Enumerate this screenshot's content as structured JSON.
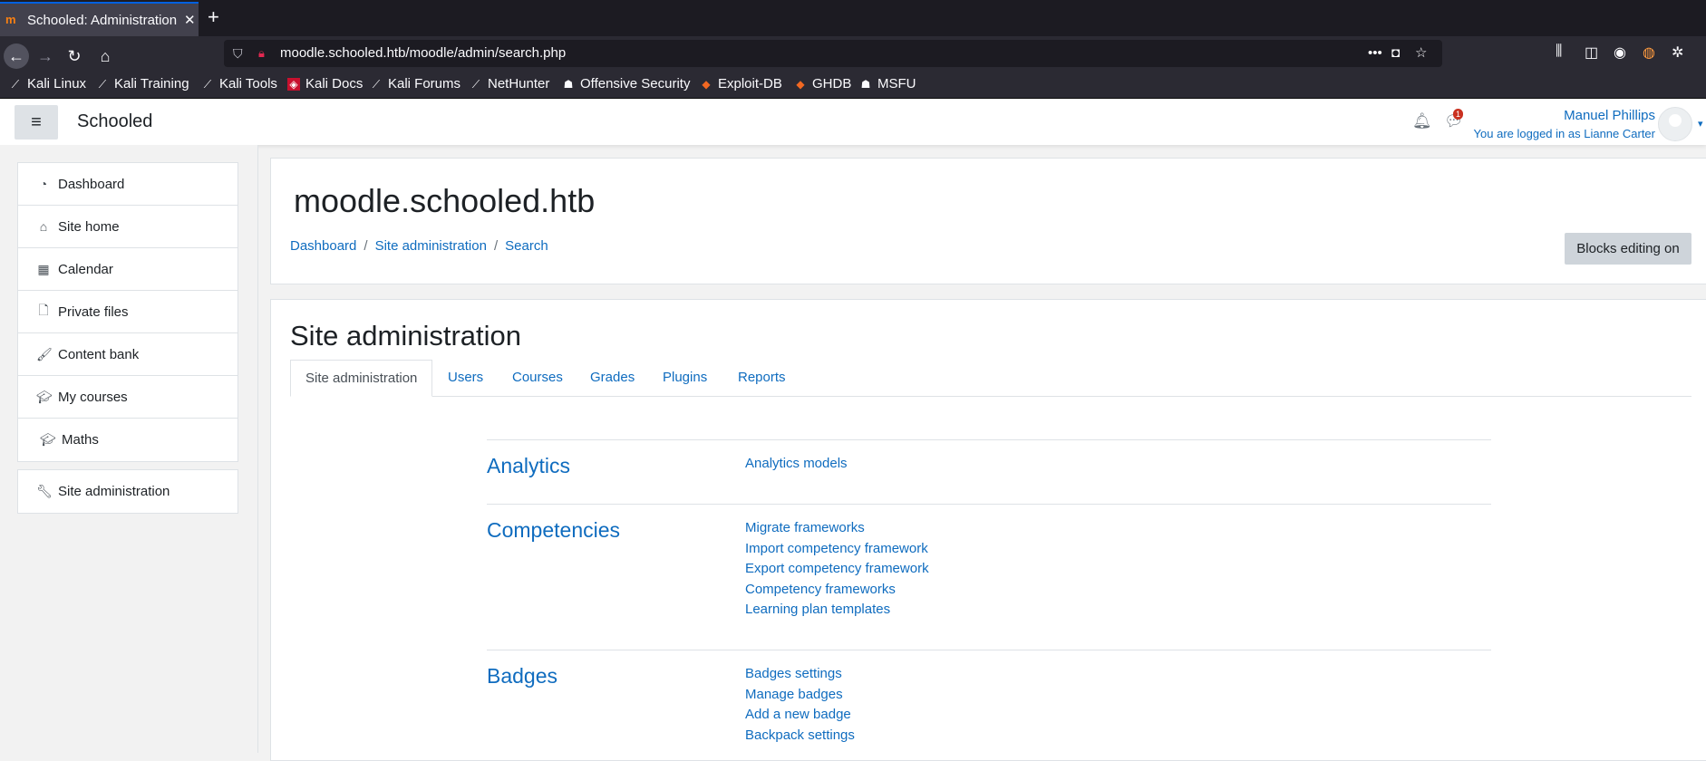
{
  "browser": {
    "tab_title": "Schooled: Administration",
    "url": "moodle.schooled.htb/moodle/admin/search.php",
    "bookmarks": [
      {
        "label": "Kali Linux"
      },
      {
        "label": "Kali Training"
      },
      {
        "label": "Kali Tools"
      },
      {
        "label": "Kali Docs"
      },
      {
        "label": "Kali Forums"
      },
      {
        "label": "NetHunter"
      },
      {
        "label": "Offensive Security"
      },
      {
        "label": "Exploit-DB"
      },
      {
        "label": "GHDB"
      },
      {
        "label": "MSFU"
      }
    ]
  },
  "header": {
    "brand": "Schooled",
    "notification_count": "1",
    "user_name": "Manuel Phillips",
    "logged_in_as": "You are logged in as Lianne Carter"
  },
  "drawer": {
    "items": [
      {
        "label": "Dashboard",
        "icon": "dashboard-icon"
      },
      {
        "label": "Site home",
        "icon": "home-icon"
      },
      {
        "label": "Calendar",
        "icon": "calendar-icon"
      },
      {
        "label": "Private files",
        "icon": "file-icon"
      },
      {
        "label": "Content bank",
        "icon": "paintbrush-icon"
      },
      {
        "label": "My courses",
        "icon": "graduation-cap-icon"
      },
      {
        "label": "Maths",
        "icon": "graduation-cap-icon"
      }
    ],
    "admin": {
      "label": "Site administration",
      "icon": "wrench-icon"
    }
  },
  "page": {
    "site_name": "moodle.schooled.htb",
    "breadcrumb": [
      "Dashboard",
      "Site administration",
      "Search"
    ],
    "blocks_editing_button": "Blocks editing on",
    "heading": "Site administration",
    "tabs": [
      "Site administration",
      "Users",
      "Courses",
      "Grades",
      "Plugins",
      "Reports"
    ],
    "sections": [
      {
        "title": "Analytics",
        "links": [
          "Analytics models"
        ]
      },
      {
        "title": "Competencies",
        "links": [
          "Migrate frameworks",
          "Import competency framework",
          "Export competency framework",
          "Competency frameworks",
          "Learning plan templates"
        ]
      },
      {
        "title": "Badges",
        "links": [
          "Badges settings",
          "Manage badges",
          "Add a new badge",
          "Backpack settings"
        ]
      }
    ]
  },
  "colors": {
    "link": "#0f6cbf",
    "text": "#1d2125",
    "browser_bg": "#1c1b22"
  }
}
